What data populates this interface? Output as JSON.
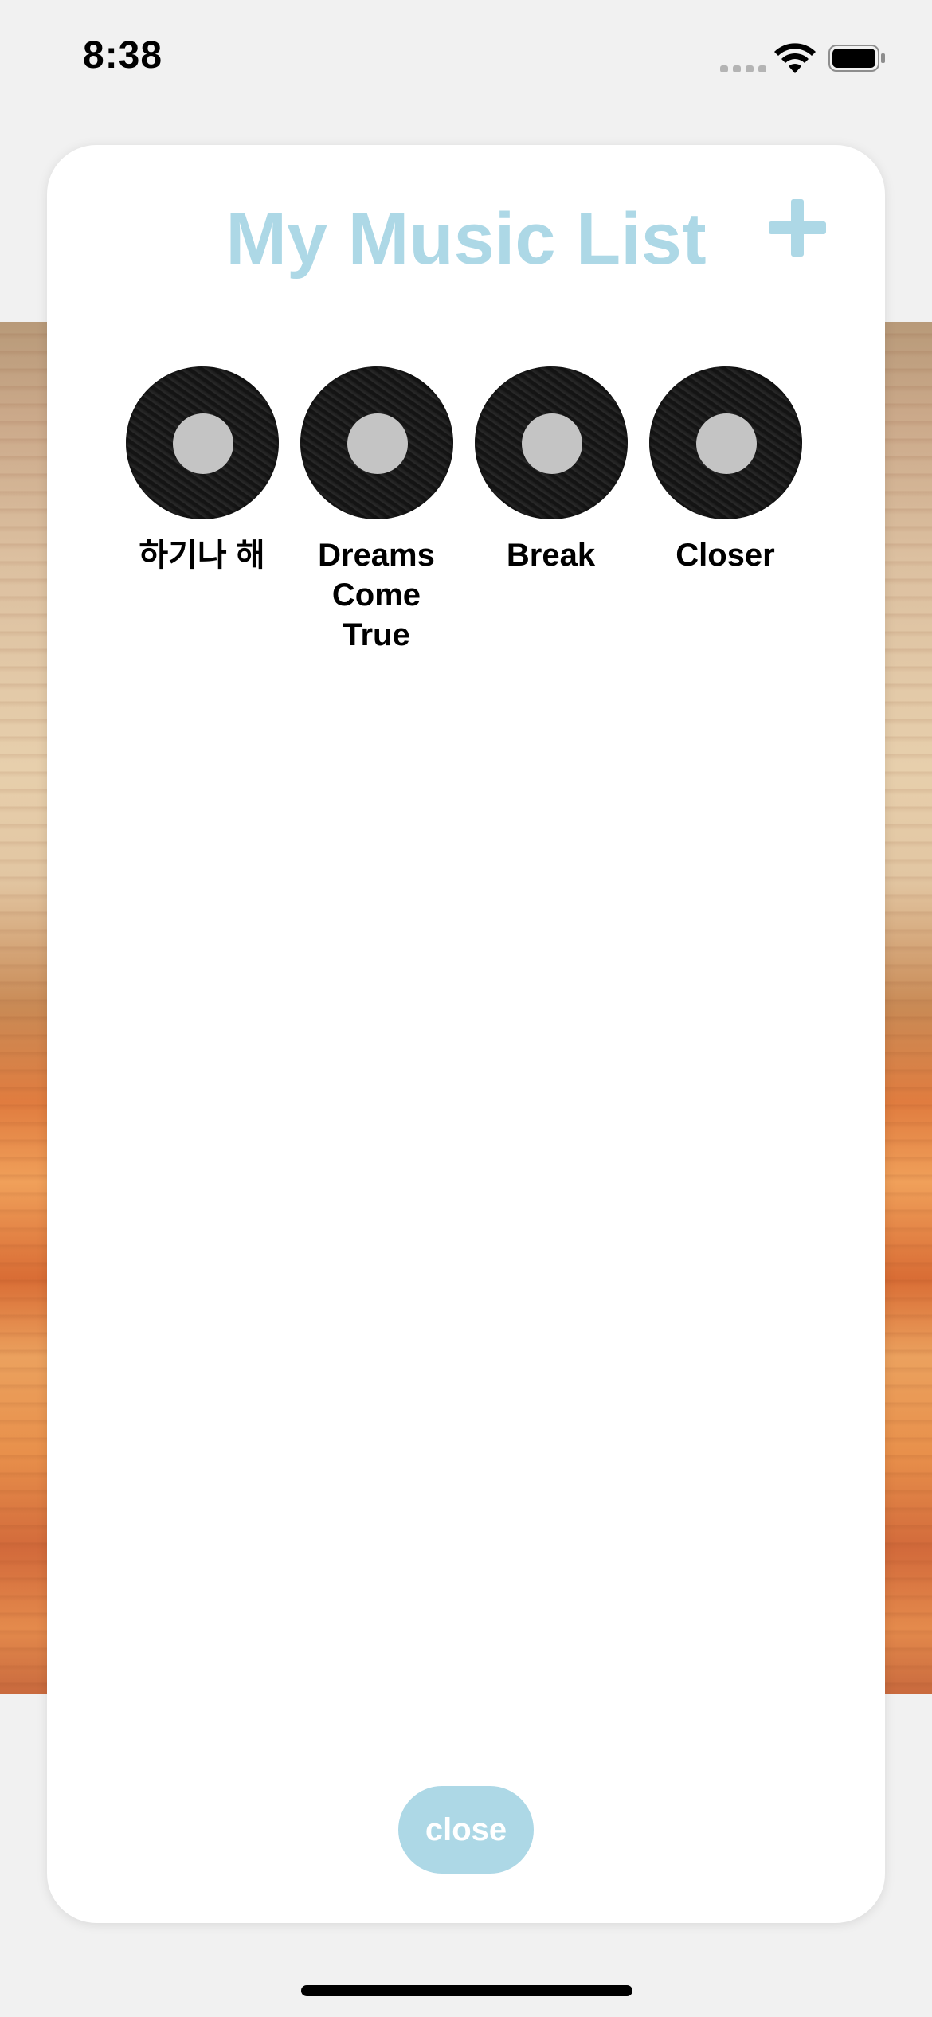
{
  "status_bar": {
    "time": "8:38",
    "wifi_icon": "wifi-icon",
    "battery_icon": "battery-icon",
    "signal_icon": "signal-icon"
  },
  "modal": {
    "title": "My Music List",
    "add_button_icon": "plus-icon",
    "songs": [
      {
        "title": "하기나 해",
        "icon": "vinyl-record-icon"
      },
      {
        "title": "Dreams Come True",
        "icon": "vinyl-record-icon"
      },
      {
        "title": "Break",
        "icon": "vinyl-record-icon"
      },
      {
        "title": "Closer",
        "icon": "vinyl-record-icon"
      }
    ],
    "close_label": "close"
  },
  "colors": {
    "accent": "#add8e6",
    "background": "#f1f1f1",
    "card": "#ffffff"
  }
}
